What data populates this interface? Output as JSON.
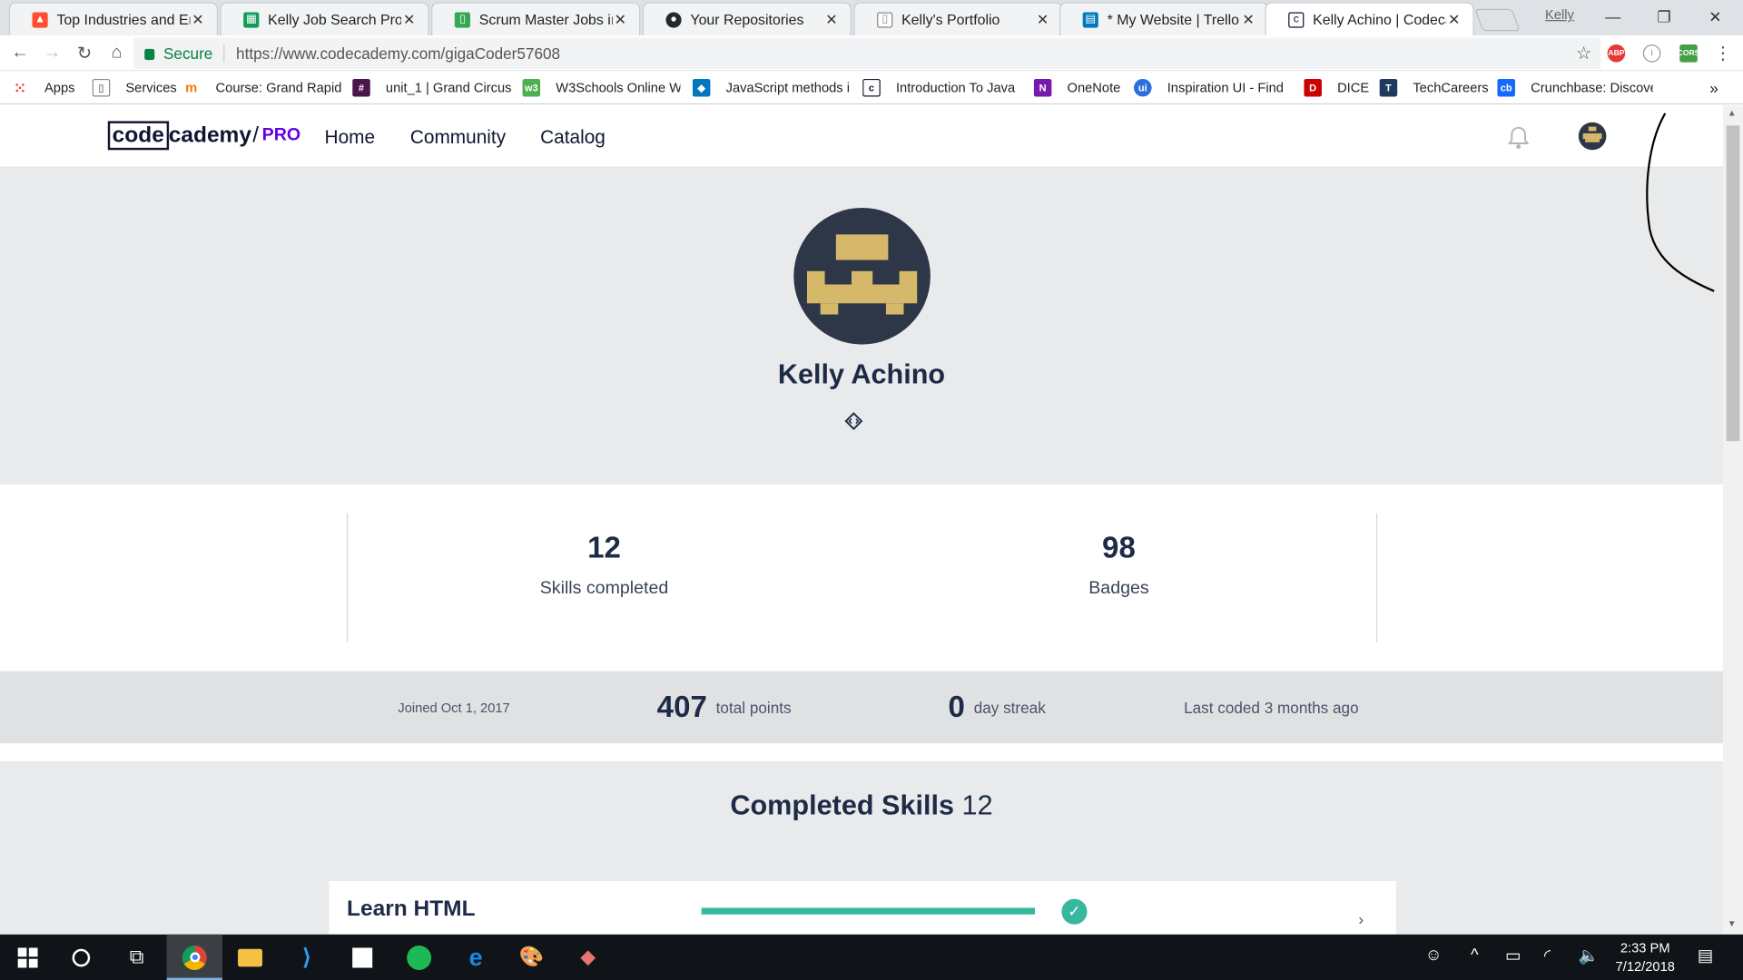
{
  "browser": {
    "tabs": [
      {
        "title": "Top Industries and Emp",
        "icon_color": "#ff4f2e"
      },
      {
        "title": "Kelly Job Search Proces",
        "icon_color": "#0f9d58"
      },
      {
        "title": "Scrum Master Jobs in G",
        "icon_color": "#34a853"
      },
      {
        "title": "Your Repositories",
        "icon_color": "#24292e"
      },
      {
        "title": "Kelly's Portfolio",
        "icon_color": "#888888"
      },
      {
        "title": "* My Website | Trello",
        "icon_color": "#0079bf"
      },
      {
        "title": "Kelly Achino | Codecad",
        "icon_color": "#10162f"
      }
    ],
    "user": "Kelly",
    "address": {
      "secure_label": "Secure",
      "url": "https://www.codecademy.com/gigaCoder57608"
    },
    "bookmarks": [
      {
        "label": "Apps",
        "icon_color": "#e94335"
      },
      {
        "label": "Services",
        "icon_color": "#888888"
      },
      {
        "label": "Course: Grand Rapid",
        "icon_color": "#f57c00"
      },
      {
        "label": "unit_1 | Grand Circus",
        "icon_color": "#4a154b"
      },
      {
        "label": "W3Schools Online W",
        "icon_color": "#4caf50"
      },
      {
        "label": "JavaScript methods i",
        "icon_color": "#0277bd"
      },
      {
        "label": "Introduction To Java",
        "icon_color": "#10162f"
      },
      {
        "label": "OneNote",
        "icon_color": "#7719aa"
      },
      {
        "label": "Inspiration UI - Find",
        "icon_color": "#2a6fdb"
      },
      {
        "label": "DICE",
        "icon_color": "#cc0000"
      },
      {
        "label": "TechCareers",
        "icon_color": "#1f3a5f"
      },
      {
        "label": "Crunchbase: Discove",
        "icon_color": "#146aff"
      }
    ]
  },
  "site": {
    "logo_code": "code",
    "logo_rest": "cademy",
    "logo_slash": "/",
    "logo_pro": "PRO",
    "nav": [
      "Home",
      "Community",
      "Catalog"
    ]
  },
  "profile": {
    "name": "Kelly Achino",
    "skills_completed": {
      "value": "12",
      "label": "Skills completed"
    },
    "badges": {
      "value": "98",
      "label": "Badges"
    },
    "joined": "Joined Oct 1, 2017",
    "points": {
      "value": "407",
      "label": "total points"
    },
    "streak": {
      "value": "0",
      "label": "day streak"
    },
    "last_coded": "Last coded 3 months ago"
  },
  "completed_skills": {
    "heading": "Completed Skills",
    "count": "12",
    "items": [
      {
        "title": "Learn HTML",
        "progress": 1.0
      }
    ]
  },
  "taskbar": {
    "time": "2:33 PM",
    "date": "7/12/2018"
  },
  "colors": {
    "accent": "#37b89e",
    "brand_dark": "#10162f",
    "pro": "#6400e4",
    "avatar_gold": "#d6b86a"
  }
}
